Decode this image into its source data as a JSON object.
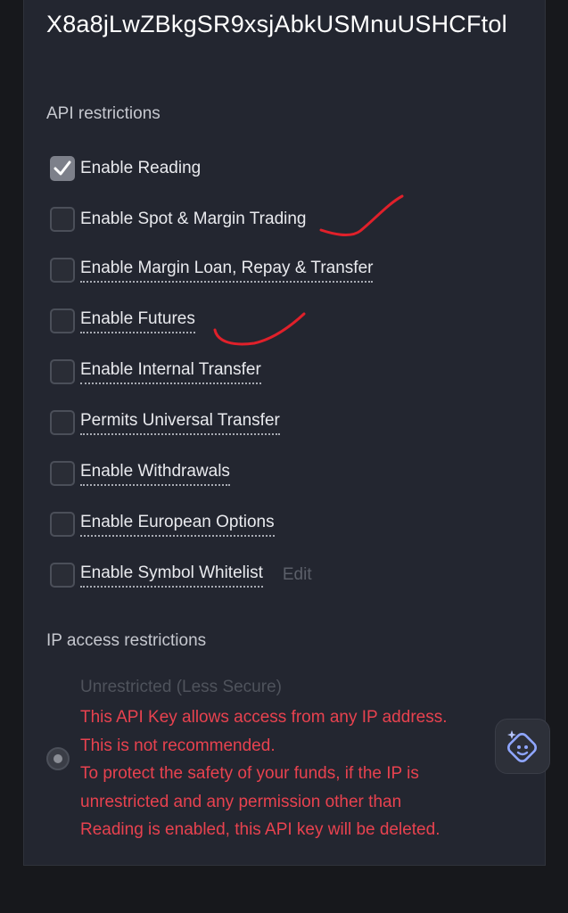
{
  "api_key": {
    "value": "X8a8jLwZBkgSR9xsjAbkUSMnuUSHCFtol"
  },
  "api_restrictions": {
    "label": "API restrictions",
    "permissions": [
      {
        "label": "Enable Reading",
        "checked": true,
        "dotted": false
      },
      {
        "label": "Enable Spot & Margin Trading",
        "checked": false,
        "dotted": false
      },
      {
        "label": "Enable Margin Loan, Repay & Transfer",
        "checked": false,
        "dotted": true
      },
      {
        "label": "Enable Futures",
        "checked": false,
        "dotted": true
      },
      {
        "label": "Enable Internal Transfer",
        "checked": false,
        "dotted": true
      },
      {
        "label": "Permits Universal Transfer",
        "checked": false,
        "dotted": true
      },
      {
        "label": "Enable Withdrawals",
        "checked": false,
        "dotted": true
      },
      {
        "label": "Enable European Options",
        "checked": false,
        "dotted": true
      },
      {
        "label": "Enable Symbol Whitelist",
        "checked": false,
        "dotted": true
      }
    ],
    "edit_label": "Edit"
  },
  "ip_access": {
    "label": "IP access restrictions",
    "option_title": "Unrestricted (Less Secure)",
    "selected": true,
    "warning_lines": [
      "This API Key allows access from any IP address.",
      "This is not recommended.",
      "To protect the safety of your funds, if the IP is",
      "unrestricted and any permission other than",
      "Reading is enabled, this API key will be deleted."
    ]
  },
  "icons": {
    "checkmark": "checkmark-icon",
    "assistant": "sparkle-face-icon"
  },
  "colors": {
    "background": "#232630",
    "warning": "#e8424f",
    "annotation": "#e0202a",
    "assistant_accent": "#8fa6ff"
  }
}
